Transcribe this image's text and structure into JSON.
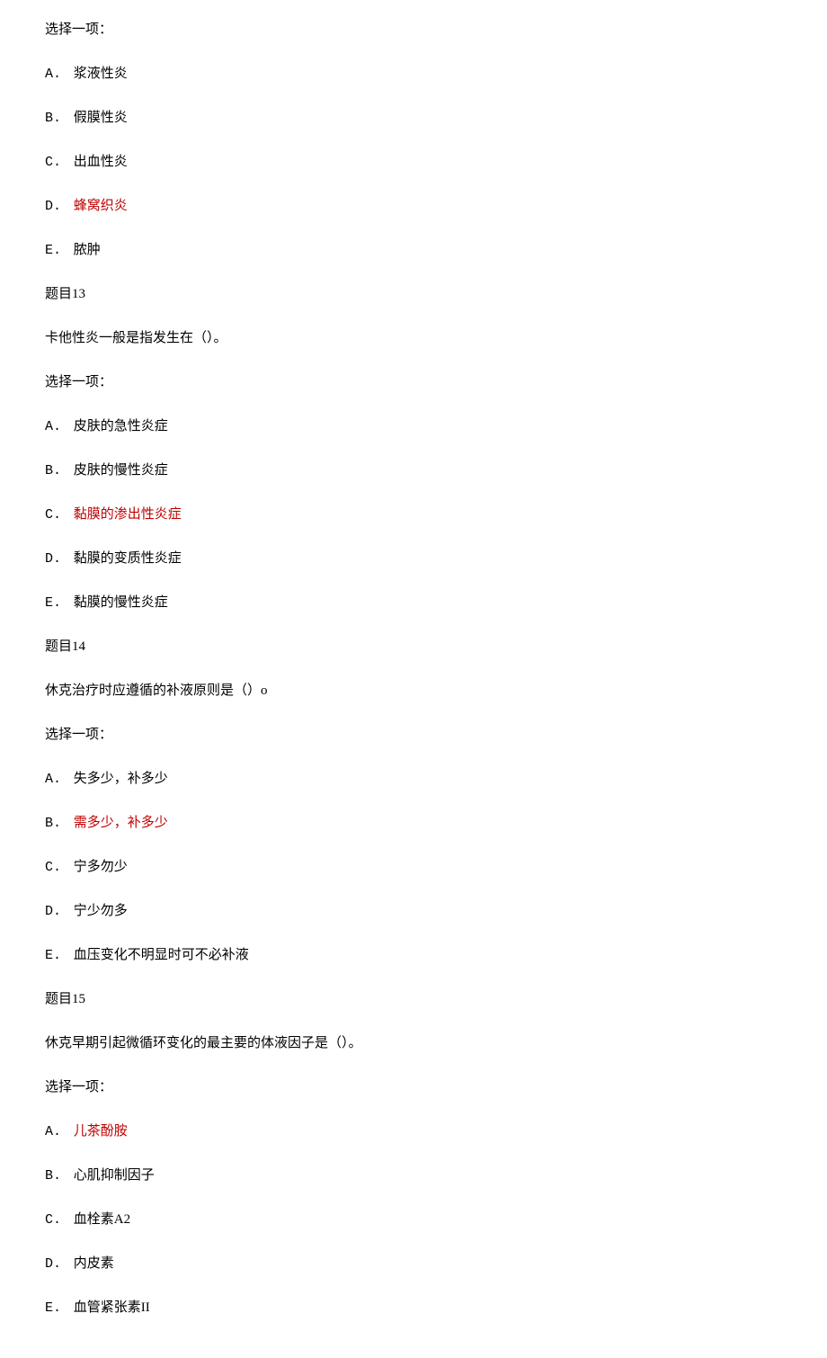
{
  "intro_select": "选择一项：",
  "q12_options": {
    "a_letter": "A.",
    "a_text": "浆液性炎",
    "b_letter": "B.",
    "b_text": "假膜性炎",
    "c_letter": "C.",
    "c_text": "出血性炎",
    "d_letter": "D.",
    "d_text": "蜂窝织炎",
    "e_letter": "E.",
    "e_text": "脓肿"
  },
  "q13_title": "题目13",
  "q13_stem": "卡他性炎一般是指发生在（）。",
  "q13_select": "选择一项：",
  "q13_options": {
    "a_letter": "A.",
    "a_text": "皮肤的急性炎症",
    "b_letter": "B.",
    "b_text": "皮肤的慢性炎症",
    "c_letter": "C.",
    "c_text": "黏膜的渗出性炎症",
    "d_letter": "D.",
    "d_text": "黏膜的变质性炎症",
    "e_letter": "E.",
    "e_text": "黏膜的慢性炎症"
  },
  "q14_title": "题目14",
  "q14_stem": "休克治疗时应遵循的补液原则是（）o",
  "q14_select": "选择一项：",
  "q14_options": {
    "a_letter": "A.",
    "a_text": "失多少，补多少",
    "b_letter": "B.",
    "b_text": "需多少，补多少",
    "c_letter": "C.",
    "c_text": "宁多勿少",
    "d_letter": "D.",
    "d_text": "宁少勿多",
    "e_letter": "E.",
    "e_text": "血压变化不明显时可不必补液"
  },
  "q15_title": "题目15",
  "q15_stem": "休克早期引起微循环变化的最主要的体液因子是（）。",
  "q15_select": "选择一项：",
  "q15_options": {
    "a_letter": "A.",
    "a_text": "儿茶酚胺",
    "b_letter": "B.",
    "b_text": "心肌抑制因子",
    "c_letter": "C.",
    "c_text": "血栓素A2",
    "d_letter": "D.",
    "d_text": "内皮素",
    "e_letter": "E.",
    "e_text": "血管紧张素II"
  }
}
